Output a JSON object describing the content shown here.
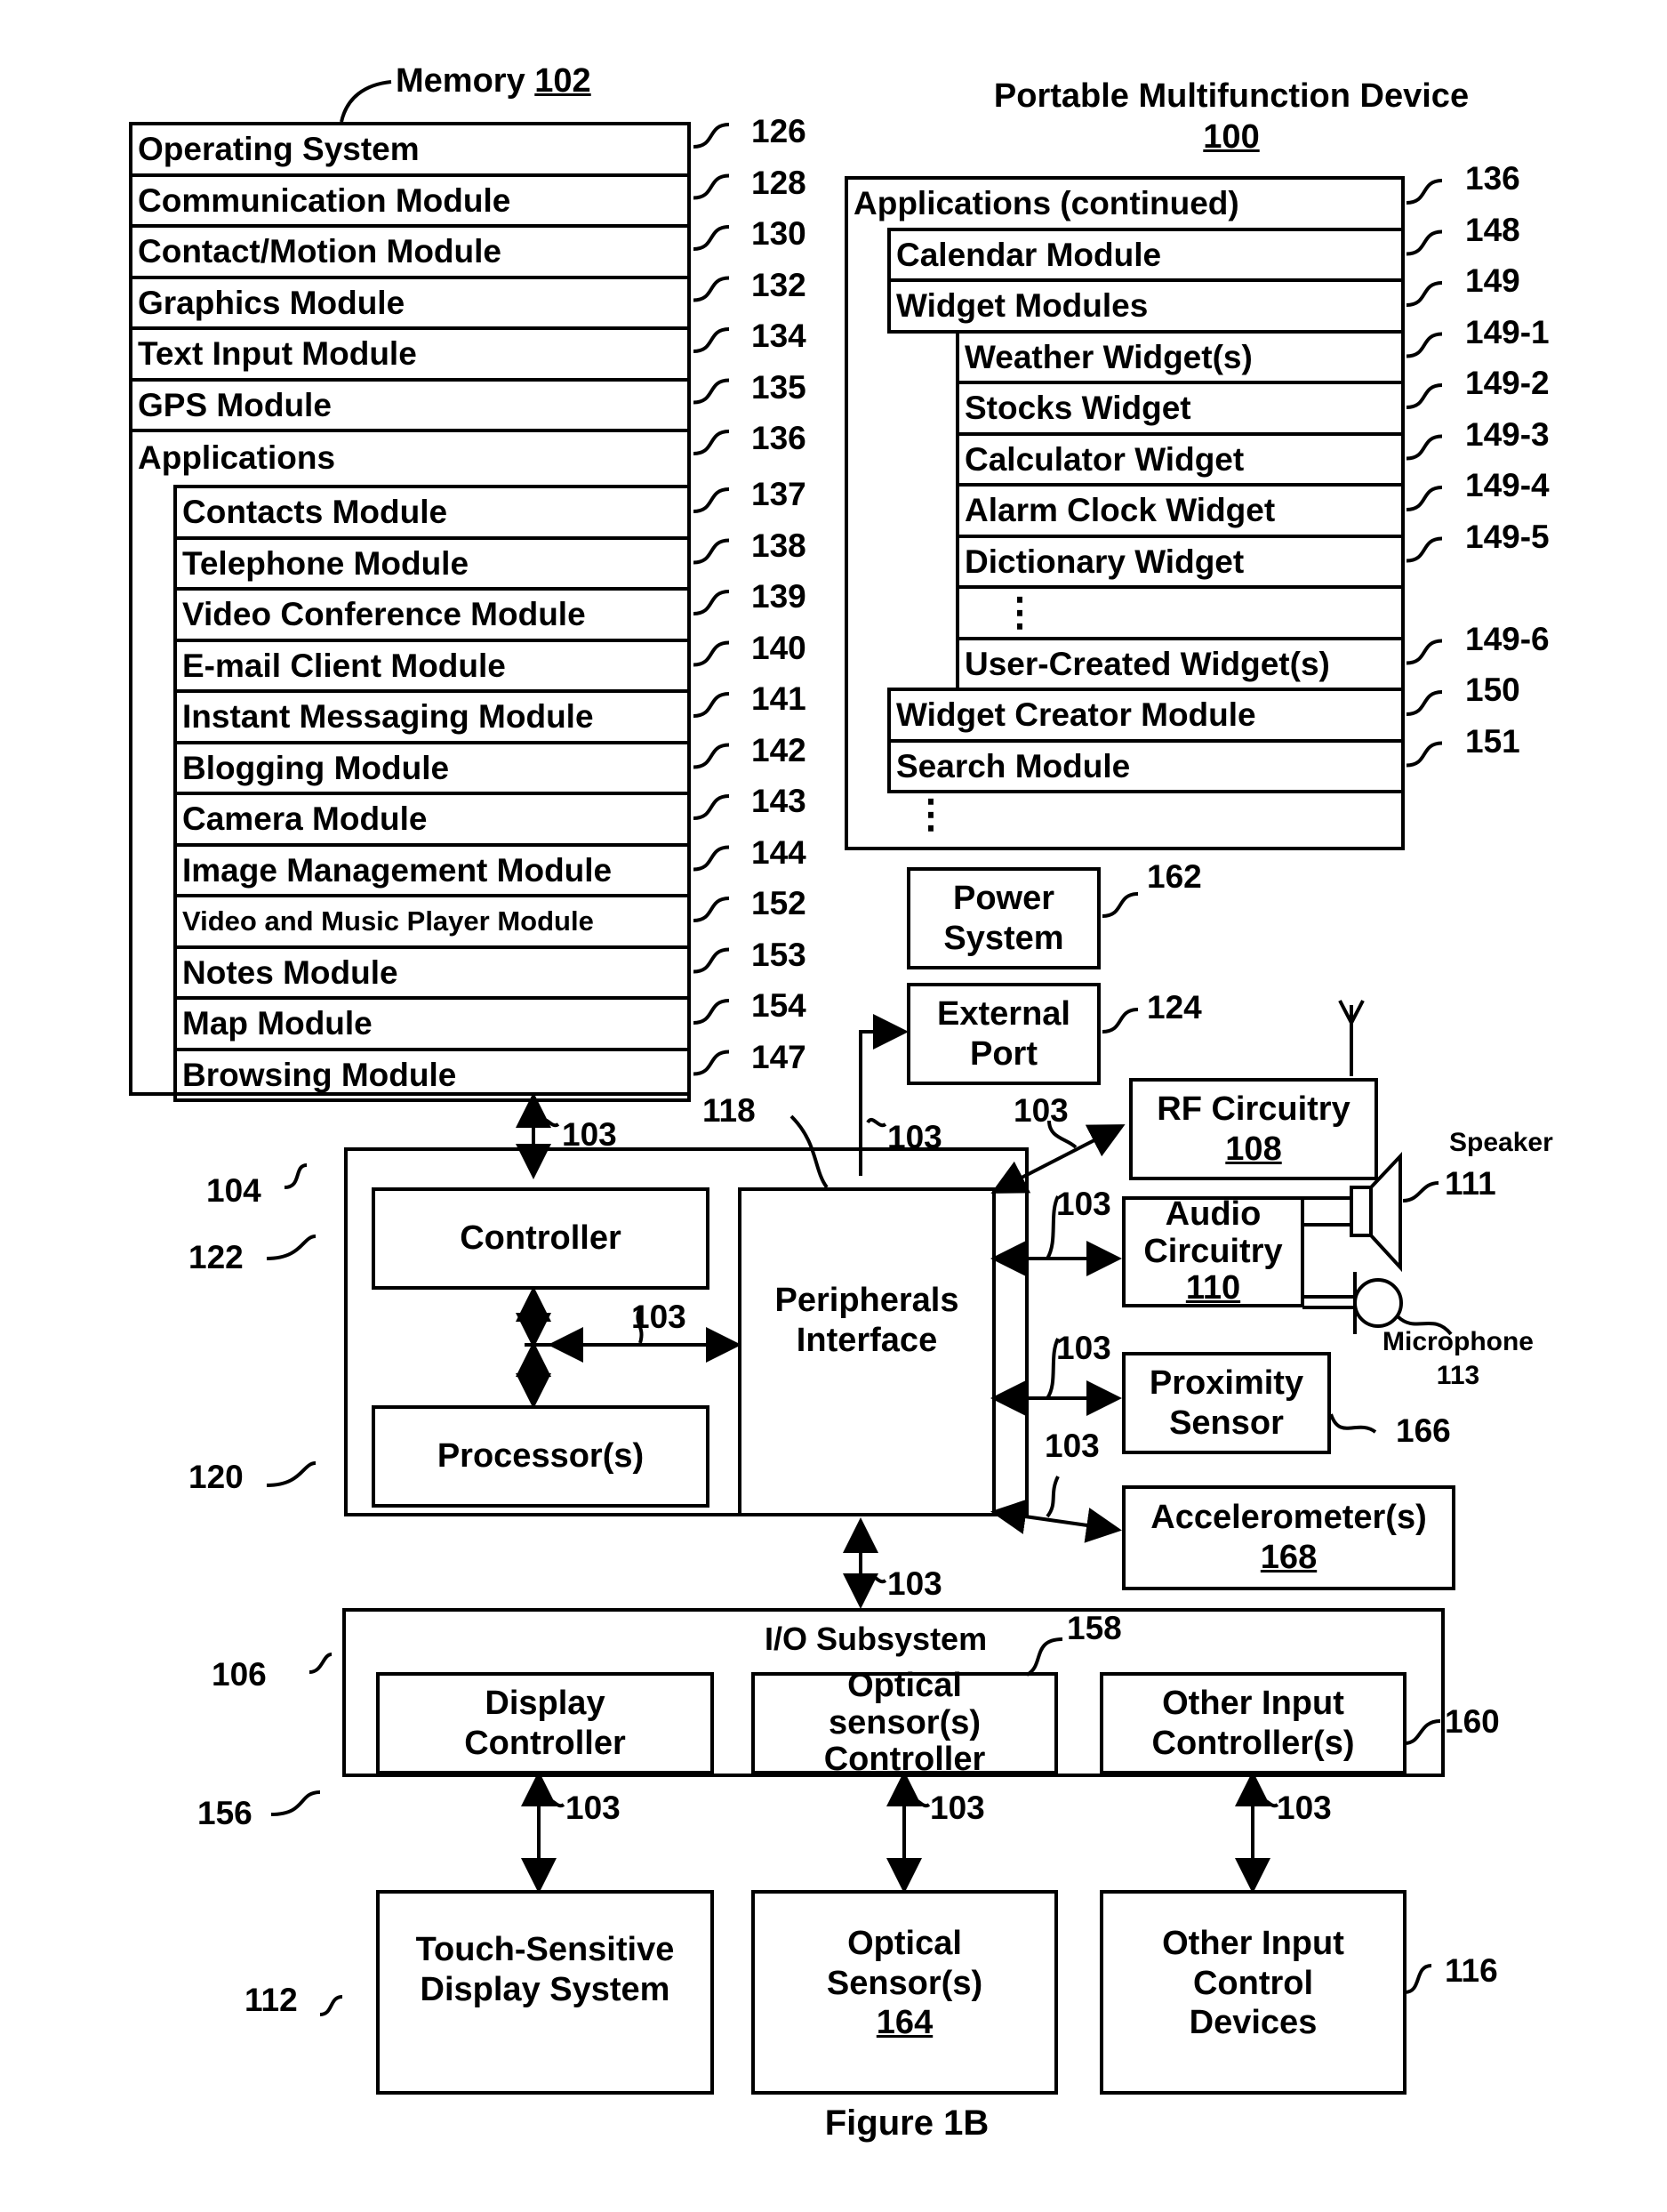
{
  "memory": {
    "label": "Memory",
    "ref": "102",
    "rows": [
      {
        "label": "Operating System",
        "ref": "126"
      },
      {
        "label": "Communication Module",
        "ref": "128"
      },
      {
        "label": "Contact/Motion Module",
        "ref": "130"
      },
      {
        "label": "Graphics Module",
        "ref": "132"
      },
      {
        "label": "Text Input Module",
        "ref": "134"
      },
      {
        "label": "GPS Module",
        "ref": "135"
      },
      {
        "label": "Applications",
        "ref": "136"
      }
    ],
    "apps": [
      {
        "label": "Contacts Module",
        "ref": "137"
      },
      {
        "label": "Telephone Module",
        "ref": "138"
      },
      {
        "label": "Video Conference Module",
        "ref": "139"
      },
      {
        "label": "E-mail Client Module",
        "ref": "140"
      },
      {
        "label": "Instant Messaging Module",
        "ref": "141"
      },
      {
        "label": "Blogging Module",
        "ref": "142"
      },
      {
        "label": "Camera Module",
        "ref": "143"
      },
      {
        "label": "Image Management Module",
        "ref": "144"
      },
      {
        "label": "Video and Music Player Module",
        "ref": "152"
      },
      {
        "label": "Notes Module",
        "ref": "153"
      },
      {
        "label": "Map Module",
        "ref": "154"
      },
      {
        "label": "Browsing Module",
        "ref": "147"
      }
    ]
  },
  "device": {
    "title": "Portable Multifunction Device",
    "ref": "100"
  },
  "apps_continued": {
    "label": "Applications (continued)",
    "ref": "136",
    "calendar": {
      "label": "Calendar Module",
      "ref": "148"
    },
    "widgets": {
      "label": "Widget Modules",
      "ref": "149"
    },
    "widget_items": [
      {
        "label": "Weather Widget(s)",
        "ref": "149-1"
      },
      {
        "label": "Stocks Widget",
        "ref": "149-2"
      },
      {
        "label": "Calculator Widget",
        "ref": "149-3"
      },
      {
        "label": "Alarm Clock Widget",
        "ref": "149-4"
      },
      {
        "label": "Dictionary Widget",
        "ref": "149-5"
      }
    ],
    "ellipsis": "⋮",
    "user_widget": {
      "label": "User-Created Widget(s)",
      "ref": "149-6"
    },
    "widget_creator": {
      "label": "Widget Creator Module",
      "ref": "150"
    },
    "search": {
      "label": "Search Module",
      "ref": "151"
    }
  },
  "power": {
    "line1": "Power",
    "line2": "System",
    "ref": "162"
  },
  "external_port": {
    "line1": "External",
    "line2": "Port",
    "ref": "124"
  },
  "rf": {
    "line1": "RF Circuitry",
    "ref": "108"
  },
  "audio": {
    "line1": "Audio",
    "line2": "Circuitry",
    "ref": "110"
  },
  "speaker": {
    "label": "Speaker",
    "ref": "111"
  },
  "microphone": {
    "label": "Microphone",
    "ref": "113"
  },
  "proximity": {
    "line1": "Proximity",
    "line2": "Sensor",
    "ref": "166"
  },
  "accelerometer": {
    "line1": "Accelerometer(s)",
    "ref": "168"
  },
  "bus_ref": "103",
  "chip": {
    "ref": "104",
    "controller": {
      "label": "Controller",
      "ref": "122"
    },
    "processor": {
      "label": "Processor(s)",
      "ref": "120"
    },
    "peripherals": {
      "line1": "Peripherals",
      "line2": "Interface",
      "ref": "118"
    }
  },
  "io": {
    "title": "I/O Subsystem",
    "ref": "106",
    "display_controller": {
      "line1": "Display",
      "line2": "Controller",
      "ref": "156"
    },
    "optical_controller": {
      "line1": "Optical",
      "line2": "sensor(s)",
      "line3": "Controller",
      "ref": "158"
    },
    "other_controller": {
      "line1": "Other Input",
      "line2": "Controller(s)",
      "ref": "160"
    }
  },
  "touch_display": {
    "line1": "Touch-Sensitive",
    "line2": "Display System",
    "ref": "112"
  },
  "optical_sensor": {
    "line1": "Optical",
    "line2": "Sensor(s)",
    "ref": "164"
  },
  "other_input": {
    "line1": "Other Input",
    "line2": "Control",
    "line3": "Devices",
    "ref": "116"
  },
  "figure_caption": "Figure 1B"
}
